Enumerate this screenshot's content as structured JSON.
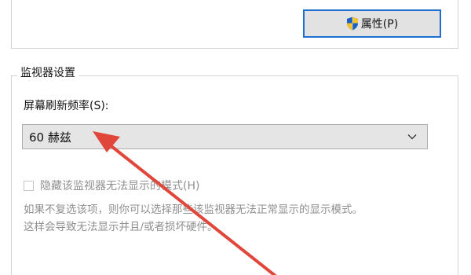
{
  "properties_button": {
    "label": "属性(P)",
    "icon": "uac-shield-icon"
  },
  "monitor_settings": {
    "legend": "监视器设置",
    "refresh_rate_label": "屏幕刷新频率(S):",
    "refresh_rate_value": "60 赫兹",
    "hide_modes_label": "隐藏该监视器无法显示的模式(H)",
    "hide_modes_checked": false,
    "description_line1": "如果不复选该项，则你可以选择那些该监视器无法正常显示的显示模式。",
    "description_line2": "这样会导致无法显示并且/或者损坏硬件。"
  },
  "annotation": {
    "arrow_color": "#e0473a"
  }
}
